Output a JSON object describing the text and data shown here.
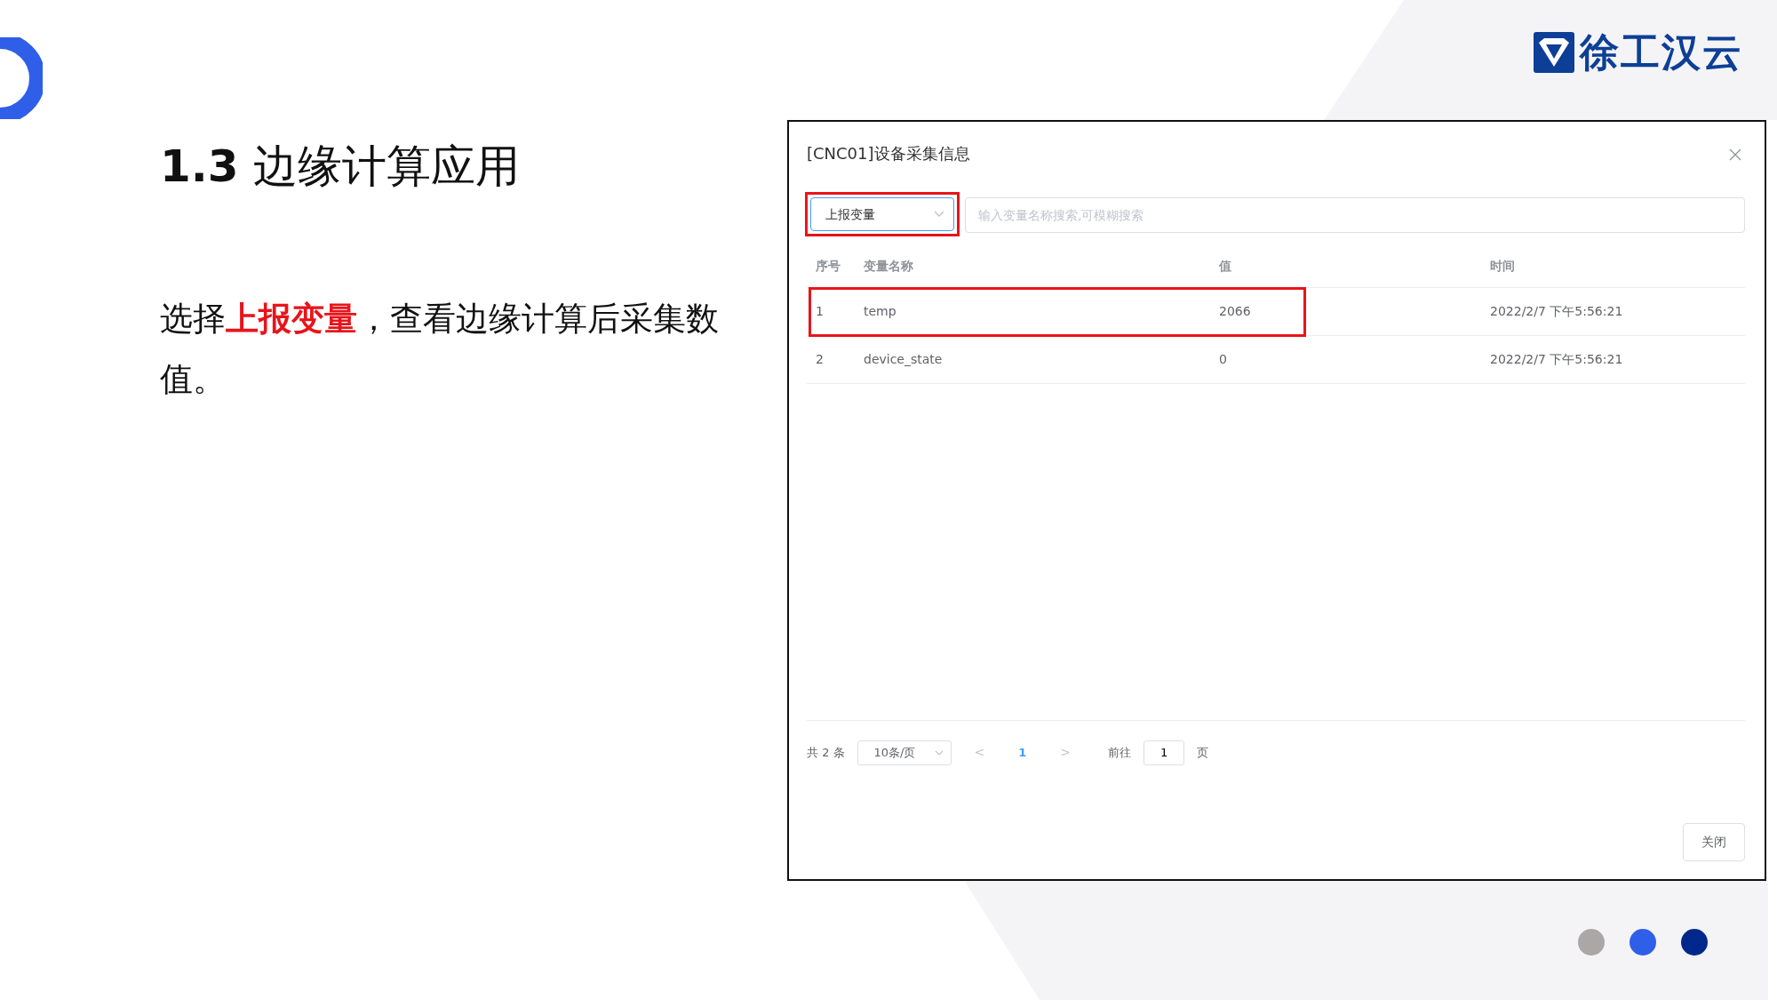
{
  "slide": {
    "heading_number": "1.3",
    "heading": "边缘计算应用",
    "body": "选择**上报变量**，查看边缘计算后采集数值。",
    "logo_text": "徐工汉云"
  },
  "dialog": {
    "title": "[CNC01]设备采集信息",
    "filter": {
      "value": "上报变量",
      "highlighted": true
    },
    "search": {
      "placeholder": "输入变量名称搜索,可模糊搜索"
    },
    "table": {
      "columns": [
        "序号",
        "变量名称",
        "值",
        "时间"
      ],
      "rows": [
        {
          "cells": [
            "1",
            "temp",
            "2066",
            "2022/2/7 下午5:56:21"
          ],
          "highlighted": true
        },
        {
          "cells": [
            "2",
            "device_state",
            "0",
            "2022/2/7 下午5:56:21"
          ],
          "highlighted": false
        }
      ]
    },
    "pagination": {
      "total": "共 2 条",
      "page_size": "10条/页",
      "prev": "<",
      "pages": [
        {
          "label": "1",
          "selected": true
        }
      ],
      "next": ">",
      "goto_label": "前往",
      "goto_value": "1",
      "goto_unit": "页"
    },
    "close_button": "关闭"
  }
}
